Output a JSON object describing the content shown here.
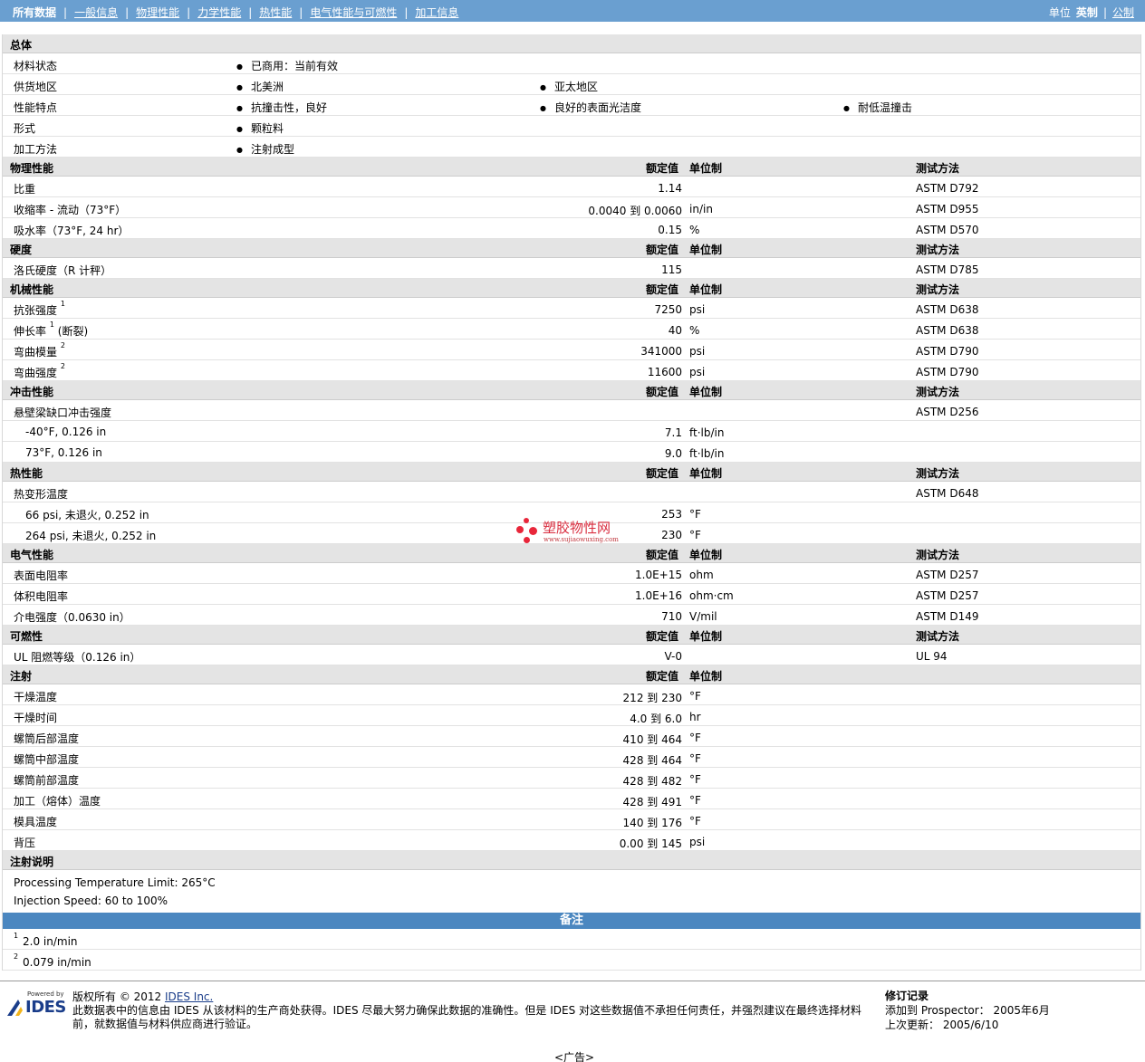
{
  "nav": {
    "tabs": [
      "所有数据",
      "一般信息",
      "物理性能",
      "力学性能",
      "热性能",
      "电气性能与可燃性",
      "加工信息"
    ],
    "units_label": "单位",
    "units_active": "英制",
    "units_other": "公制"
  },
  "general": {
    "title": "总体",
    "rows": [
      {
        "label": "材料状态",
        "items": [
          "已商用：当前有效"
        ]
      },
      {
        "label": "供货地区",
        "items": [
          "北美洲",
          "亚太地区"
        ]
      },
      {
        "label": "性能特点",
        "items": [
          "抗撞击性，良好",
          "良好的表面光洁度",
          "耐低温撞击"
        ]
      },
      {
        "label": "形式",
        "items": [
          "颗粒料"
        ]
      },
      {
        "label": "加工方法",
        "items": [
          "注射成型"
        ]
      }
    ]
  },
  "col_headers": {
    "nominal": "额定值",
    "unit": "单位制",
    "test": "测试方法"
  },
  "sections": [
    {
      "title": "物理性能",
      "show_test": true,
      "rows": [
        {
          "label": "比重",
          "value": "1.14",
          "unit": "",
          "test": "ASTM D792"
        },
        {
          "label": "收缩率 - 流动（73°F）",
          "value": "0.0040 到 0.0060",
          "unit": "in/in",
          "test": "ASTM D955"
        },
        {
          "label": "吸水率（73°F, 24 hr）",
          "value": "0.15",
          "unit": "%",
          "test": "ASTM D570"
        }
      ]
    },
    {
      "title": "硬度",
      "show_test": true,
      "rows": [
        {
          "label": "洛氏硬度（R 计秤）",
          "value": "115",
          "unit": "",
          "test": "ASTM D785"
        }
      ]
    },
    {
      "title": "机械性能",
      "show_test": true,
      "rows": [
        {
          "label": "抗张强度",
          "sup": "1",
          "label2": "",
          "value": "7250",
          "unit": "psi",
          "test": "ASTM D638"
        },
        {
          "label": "伸长率",
          "sup": "1",
          "label2": "(断裂)",
          "value": "40",
          "unit": "%",
          "test": "ASTM D638"
        },
        {
          "label": "弯曲模量",
          "sup": "2",
          "label2": "",
          "value": "341000",
          "unit": "psi",
          "test": "ASTM D790"
        },
        {
          "label": "弯曲强度",
          "sup": "2",
          "label2": "",
          "value": "11600",
          "unit": "psi",
          "test": "ASTM D790"
        }
      ]
    },
    {
      "title": "冲击性能",
      "show_test": true,
      "rows": [
        {
          "label": "悬壁梁缺口冲击强度",
          "value": "",
          "unit": "",
          "test": "ASTM D256"
        },
        {
          "label": "-40°F, 0.126 in",
          "indent": true,
          "value": "7.1",
          "unit": "ft·lb/in",
          "test": ""
        },
        {
          "label": "73°F, 0.126 in",
          "indent": true,
          "value": "9.0",
          "unit": "ft·lb/in",
          "test": ""
        }
      ]
    },
    {
      "title": "热性能",
      "show_test": true,
      "rows": [
        {
          "label": "热变形温度",
          "value": "",
          "unit": "",
          "test": "ASTM D648"
        },
        {
          "label": "66 psi, 未退火, 0.252 in",
          "indent": true,
          "value": "253",
          "unit": "°F",
          "test": ""
        },
        {
          "label": "264 psi, 未退火, 0.252 in",
          "indent": true,
          "value": "230",
          "unit": "°F",
          "test": ""
        }
      ]
    },
    {
      "title": "电气性能",
      "show_test": true,
      "rows": [
        {
          "label": "表面电阻率",
          "value": "1.0E+15",
          "unit": "ohm",
          "test": "ASTM D257"
        },
        {
          "label": "体积电阻率",
          "value": "1.0E+16",
          "unit": "ohm·cm",
          "test": "ASTM D257"
        },
        {
          "label": "介电强度（0.0630 in）",
          "value": "710",
          "unit": "V/mil",
          "test": "ASTM D149"
        }
      ]
    },
    {
      "title": "可燃性",
      "show_test": true,
      "rows": [
        {
          "label": "UL 阻燃等级（0.126 in）",
          "value": "V-0",
          "unit": "",
          "test": "UL 94"
        }
      ]
    },
    {
      "title": "注射",
      "show_test": false,
      "rows": [
        {
          "label": "干燥温度",
          "value": "212 到 230",
          "unit": "°F",
          "test": ""
        },
        {
          "label": "干燥时间",
          "value": "4.0 到 6.0",
          "unit": "hr",
          "test": ""
        },
        {
          "label": "螺筒后部温度",
          "value": "410 到 464",
          "unit": "°F",
          "test": ""
        },
        {
          "label": "螺筒中部温度",
          "value": "428 到 464",
          "unit": "°F",
          "test": ""
        },
        {
          "label": "螺筒前部温度",
          "value": "428 到 482",
          "unit": "°F",
          "test": ""
        },
        {
          "label": "加工（熔体）温度",
          "value": "428 到 491",
          "unit": "°F",
          "test": ""
        },
        {
          "label": "模具温度",
          "value": "140 到 176",
          "unit": "°F",
          "test": ""
        },
        {
          "label": "背压",
          "value": "0.00 到 145",
          "unit": "psi",
          "test": ""
        }
      ]
    }
  ],
  "injection_notes": {
    "title": "注射说明",
    "lines": [
      "Processing Temperature Limit: 265°C",
      "Injection Speed: 60 to 100%"
    ]
  },
  "remarks": {
    "title": "备注",
    "items": [
      {
        "sup": "1",
        "text": "2.0 in/min"
      },
      {
        "sup": "2",
        "text": "0.079 in/min"
      }
    ]
  },
  "watermark": {
    "name": "塑胶物性网",
    "url": "www.sujiaowuxing.com"
  },
  "footer": {
    "powered": "Powered by",
    "logo_text": "IDES",
    "copyright_prefix": "版权所有 © 2012 ",
    "copyright_link": "IDES Inc.",
    "disclaimer": "此数据表中的信息由 IDES 从该材料的生产商处获得。IDES 尽最大努力确保此数据的准确性。但是 IDES 对这些数据值不承担任何责任，并强烈建议在最终选择材料前，就数据值与材料供应商进行验证。",
    "revision_title": "修订记录",
    "added_label": "添加到 Prospector：",
    "added_value": "2005年6月",
    "updated_label": "上次更新：",
    "updated_value": "2005/6/10"
  },
  "ad_label": "<广告>"
}
